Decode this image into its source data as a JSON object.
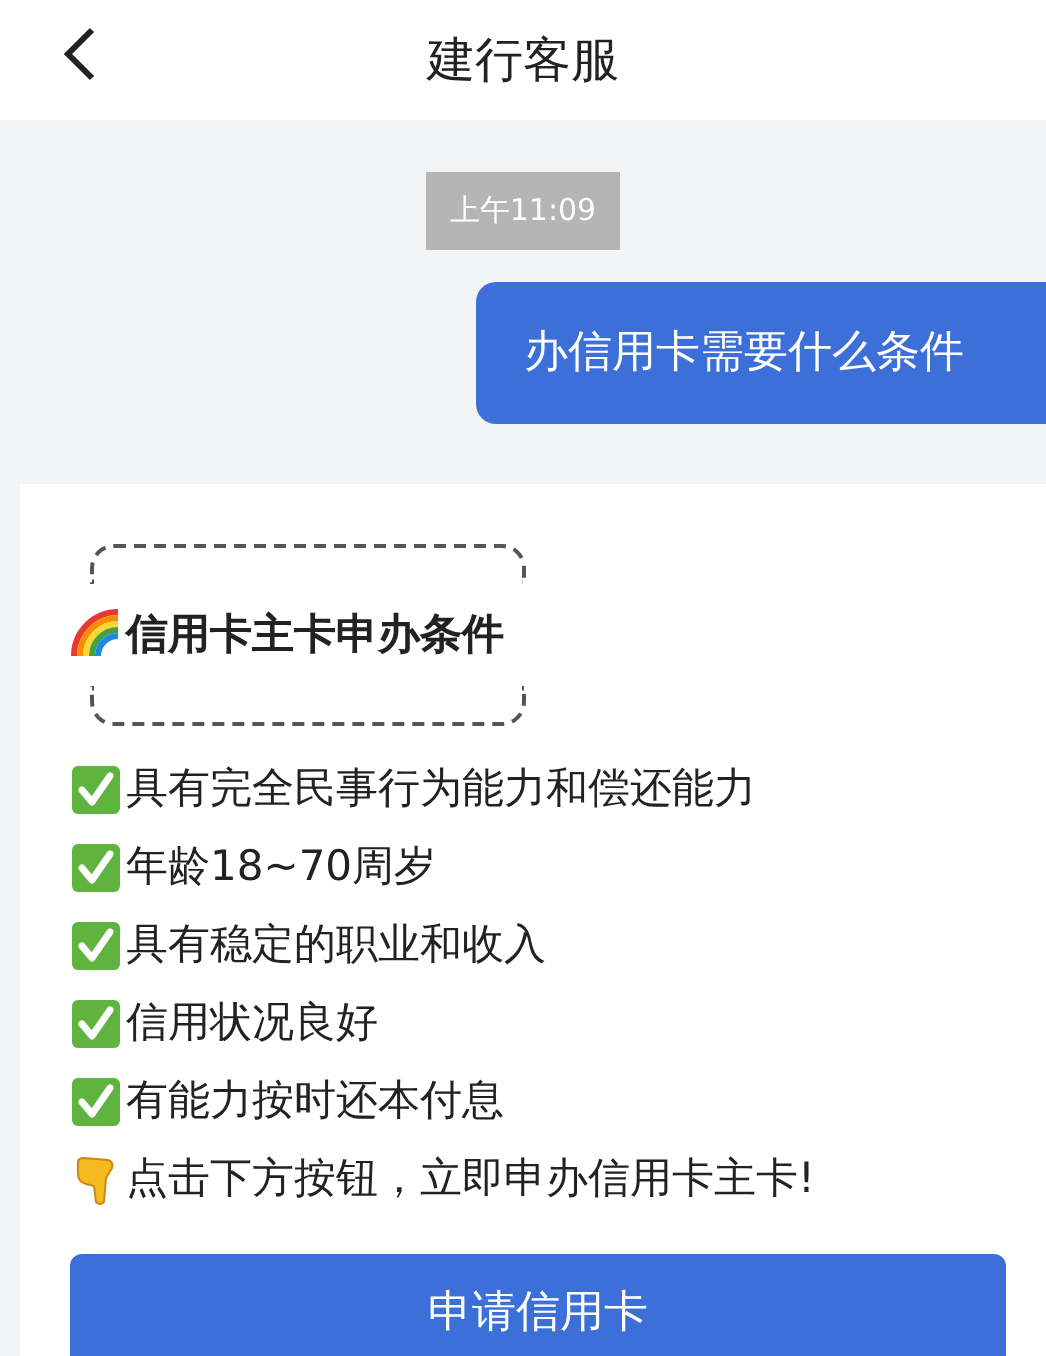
{
  "header": {
    "title": "建行客服"
  },
  "timestamp": "上午11:09",
  "user_message": "办信用卡需要什么条件",
  "reply_card": {
    "title": "信用卡主卡申办条件",
    "lines": [
      {
        "kind": "check",
        "text": "具有完全民事行为能力和偿还能力"
      },
      {
        "kind": "check",
        "text": "年龄18~70周岁"
      },
      {
        "kind": "check",
        "text": "具有稳定的职业和收入"
      },
      {
        "kind": "check",
        "text": "信用状况良好"
      },
      {
        "kind": "check",
        "text": "有能力按时还本付息"
      },
      {
        "kind": "point",
        "text": "点击下方按钮，立即申办信用卡主卡!"
      }
    ],
    "button": "申请信用卡"
  }
}
